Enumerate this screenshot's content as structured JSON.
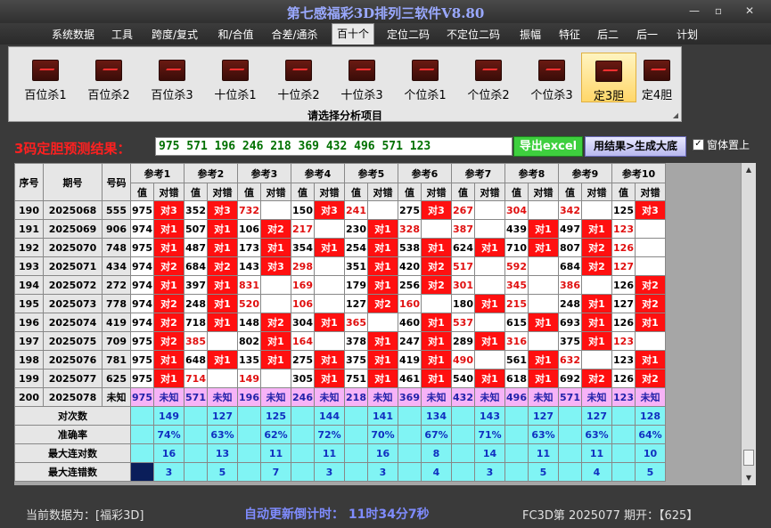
{
  "app": {
    "title": "第七感福彩3D排列三软件V8.80"
  },
  "window_controls": {
    "minimize": "—",
    "maximize": "▫",
    "close": "✕"
  },
  "menu": [
    {
      "label": "系统数据",
      "active": false
    },
    {
      "label": "工具",
      "active": false
    },
    {
      "label": "跨度/复式",
      "active": false
    },
    {
      "label": "和/合值",
      "active": false
    },
    {
      "label": "合差/通杀",
      "active": false
    },
    {
      "label": "百十个",
      "active": true
    },
    {
      "label": "定位二码",
      "active": false
    },
    {
      "label": "不定位二码",
      "active": false
    },
    {
      "label": "振幅",
      "active": false
    },
    {
      "label": "特征",
      "active": false
    },
    {
      "label": "后二",
      "active": false
    },
    {
      "label": "后一",
      "active": false
    },
    {
      "label": "计划",
      "active": false
    }
  ],
  "ribbon": {
    "buttons": [
      {
        "label": "百位杀1",
        "icon": "chart-icon",
        "selected": false
      },
      {
        "label": "百位杀2",
        "icon": "chart-icon",
        "selected": false
      },
      {
        "label": "百位杀3",
        "icon": "chart-icon",
        "selected": false
      },
      {
        "label": "十位杀1",
        "icon": "chart-icon",
        "selected": false
      },
      {
        "label": "十位杀2",
        "icon": "chart-icon",
        "selected": false
      },
      {
        "label": "十位杀3",
        "icon": "chart-icon",
        "selected": false
      },
      {
        "label": "个位杀1",
        "icon": "chart-icon",
        "selected": false
      },
      {
        "label": "个位杀2",
        "icon": "chart-icon",
        "selected": false
      },
      {
        "label": "个位杀3",
        "icon": "chart-icon",
        "selected": false
      },
      {
        "label": "定3胆",
        "icon": "chart-icon",
        "selected": true
      },
      {
        "label": "定4胆",
        "icon": "chart-icon",
        "selected": false
      }
    ],
    "caption": "请选择分析项目"
  },
  "result": {
    "label": "3码定胆预测结果：",
    "value": "975 571 196 246 218 369 432 496 571 123",
    "export_button": "导出excel",
    "apply_button": "用结果>生成大底",
    "ontop_checked": "✓",
    "ontop_label": "窗体置上"
  },
  "table": {
    "headers": {
      "seq": "序号",
      "period": "期号",
      "code": "号码",
      "value": "值",
      "check": "对错"
    },
    "refs": [
      "参考1",
      "参考2",
      "参考3",
      "参考4",
      "参考5",
      "参考6",
      "参考7",
      "参考8",
      "参考9",
      "参考10"
    ],
    "rows": [
      {
        "seq": "190",
        "period": "2025068",
        "code": "555",
        "cells": [
          {
            "v": "975",
            "red": false,
            "c": "对3"
          },
          {
            "v": "352",
            "red": false,
            "c": "对3"
          },
          {
            "v": "732",
            "red": true,
            "c": ""
          },
          {
            "v": "150",
            "red": false,
            "c": "对3"
          },
          {
            "v": "241",
            "red": true,
            "c": ""
          },
          {
            "v": "275",
            "red": false,
            "c": "对3"
          },
          {
            "v": "267",
            "red": true,
            "c": ""
          },
          {
            "v": "304",
            "red": true,
            "c": ""
          },
          {
            "v": "342",
            "red": true,
            "c": ""
          },
          {
            "v": "125",
            "red": false,
            "c": "对3"
          }
        ]
      },
      {
        "seq": "191",
        "period": "2025069",
        "code": "906",
        "cells": [
          {
            "v": "974",
            "red": false,
            "c": "对1"
          },
          {
            "v": "507",
            "red": false,
            "c": "对1"
          },
          {
            "v": "106",
            "red": false,
            "c": "对2"
          },
          {
            "v": "217",
            "red": true,
            "c": ""
          },
          {
            "v": "230",
            "red": false,
            "c": "对1"
          },
          {
            "v": "328",
            "red": true,
            "c": ""
          },
          {
            "v": "387",
            "red": true,
            "c": ""
          },
          {
            "v": "439",
            "red": false,
            "c": "对1"
          },
          {
            "v": "497",
            "red": false,
            "c": "对1"
          },
          {
            "v": "123",
            "red": true,
            "c": ""
          }
        ]
      },
      {
        "seq": "192",
        "period": "2025070",
        "code": "748",
        "cells": [
          {
            "v": "975",
            "red": false,
            "c": "对1"
          },
          {
            "v": "487",
            "red": false,
            "c": "对1"
          },
          {
            "v": "173",
            "red": false,
            "c": "对1"
          },
          {
            "v": "354",
            "red": false,
            "c": "对1"
          },
          {
            "v": "254",
            "red": false,
            "c": "对1"
          },
          {
            "v": "538",
            "red": false,
            "c": "对1"
          },
          {
            "v": "624",
            "red": false,
            "c": "对1"
          },
          {
            "v": "710",
            "red": false,
            "c": "对1"
          },
          {
            "v": "807",
            "red": false,
            "c": "对2"
          },
          {
            "v": "126",
            "red": true,
            "c": ""
          }
        ]
      },
      {
        "seq": "193",
        "period": "2025071",
        "code": "434",
        "cells": [
          {
            "v": "974",
            "red": false,
            "c": "对2"
          },
          {
            "v": "684",
            "red": false,
            "c": "对2"
          },
          {
            "v": "143",
            "red": false,
            "c": "对3"
          },
          {
            "v": "298",
            "red": true,
            "c": ""
          },
          {
            "v": "351",
            "red": false,
            "c": "对1"
          },
          {
            "v": "420",
            "red": false,
            "c": "对2"
          },
          {
            "v": "517",
            "red": true,
            "c": ""
          },
          {
            "v": "592",
            "red": true,
            "c": ""
          },
          {
            "v": "684",
            "red": false,
            "c": "对2"
          },
          {
            "v": "127",
            "red": true,
            "c": ""
          }
        ]
      },
      {
        "seq": "194",
        "period": "2025072",
        "code": "272",
        "cells": [
          {
            "v": "974",
            "red": false,
            "c": "对1"
          },
          {
            "v": "397",
            "red": false,
            "c": "对1"
          },
          {
            "v": "831",
            "red": true,
            "c": ""
          },
          {
            "v": "169",
            "red": true,
            "c": ""
          },
          {
            "v": "179",
            "red": false,
            "c": "对1"
          },
          {
            "v": "256",
            "red": false,
            "c": "对2"
          },
          {
            "v": "301",
            "red": true,
            "c": ""
          },
          {
            "v": "345",
            "red": true,
            "c": ""
          },
          {
            "v": "386",
            "red": true,
            "c": ""
          },
          {
            "v": "126",
            "red": false,
            "c": "对2"
          }
        ]
      },
      {
        "seq": "195",
        "period": "2025073",
        "code": "778",
        "cells": [
          {
            "v": "974",
            "red": false,
            "c": "对2"
          },
          {
            "v": "248",
            "red": false,
            "c": "对1"
          },
          {
            "v": "520",
            "red": true,
            "c": ""
          },
          {
            "v": "106",
            "red": true,
            "c": ""
          },
          {
            "v": "127",
            "red": false,
            "c": "对2"
          },
          {
            "v": "160",
            "red": true,
            "c": ""
          },
          {
            "v": "180",
            "red": false,
            "c": "对1"
          },
          {
            "v": "215",
            "red": true,
            "c": ""
          },
          {
            "v": "248",
            "red": false,
            "c": "对1"
          },
          {
            "v": "127",
            "red": false,
            "c": "对2"
          }
        ]
      },
      {
        "seq": "196",
        "period": "2025074",
        "code": "419",
        "cells": [
          {
            "v": "974",
            "red": false,
            "c": "对2"
          },
          {
            "v": "718",
            "red": false,
            "c": "对1"
          },
          {
            "v": "148",
            "red": false,
            "c": "对2"
          },
          {
            "v": "304",
            "red": false,
            "c": "对1"
          },
          {
            "v": "365",
            "red": true,
            "c": ""
          },
          {
            "v": "460",
            "red": false,
            "c": "对1"
          },
          {
            "v": "537",
            "red": true,
            "c": ""
          },
          {
            "v": "615",
            "red": false,
            "c": "对1"
          },
          {
            "v": "693",
            "red": false,
            "c": "对1"
          },
          {
            "v": "126",
            "red": false,
            "c": "对1"
          }
        ]
      },
      {
        "seq": "197",
        "period": "2025075",
        "code": "709",
        "cells": [
          {
            "v": "975",
            "red": false,
            "c": "对2"
          },
          {
            "v": "385",
            "red": true,
            "c": ""
          },
          {
            "v": "802",
            "red": false,
            "c": "对1"
          },
          {
            "v": "164",
            "red": true,
            "c": ""
          },
          {
            "v": "378",
            "red": false,
            "c": "对1"
          },
          {
            "v": "247",
            "red": false,
            "c": "对1"
          },
          {
            "v": "289",
            "red": false,
            "c": "对1"
          },
          {
            "v": "316",
            "red": true,
            "c": ""
          },
          {
            "v": "375",
            "red": false,
            "c": "对1"
          },
          {
            "v": "123",
            "red": true,
            "c": ""
          }
        ]
      },
      {
        "seq": "198",
        "period": "2025076",
        "code": "781",
        "cells": [
          {
            "v": "975",
            "red": false,
            "c": "对1"
          },
          {
            "v": "648",
            "red": false,
            "c": "对1"
          },
          {
            "v": "135",
            "red": false,
            "c": "对1"
          },
          {
            "v": "275",
            "red": false,
            "c": "对1"
          },
          {
            "v": "375",
            "red": false,
            "c": "对1"
          },
          {
            "v": "419",
            "red": false,
            "c": "对1"
          },
          {
            "v": "490",
            "red": true,
            "c": ""
          },
          {
            "v": "561",
            "red": false,
            "c": "对1"
          },
          {
            "v": "632",
            "red": true,
            "c": ""
          },
          {
            "v": "123",
            "red": false,
            "c": "对1"
          }
        ]
      },
      {
        "seq": "199",
        "period": "2025077",
        "code": "625",
        "cells": [
          {
            "v": "975",
            "red": false,
            "c": "对1"
          },
          {
            "v": "714",
            "red": true,
            "c": ""
          },
          {
            "v": "149",
            "red": true,
            "c": ""
          },
          {
            "v": "305",
            "red": false,
            "c": "对1"
          },
          {
            "v": "751",
            "red": false,
            "c": "对1"
          },
          {
            "v": "461",
            "red": false,
            "c": "对1"
          },
          {
            "v": "540",
            "red": false,
            "c": "对1"
          },
          {
            "v": "618",
            "red": false,
            "c": "对1"
          },
          {
            "v": "692",
            "red": false,
            "c": "对2"
          },
          {
            "v": "126",
            "red": false,
            "c": "对2"
          }
        ]
      }
    ],
    "pending_row": {
      "seq": "200",
      "period": "2025078",
      "code": "未知",
      "values": [
        "975",
        "571",
        "196",
        "246",
        "218",
        "369",
        "432",
        "496",
        "571",
        "123"
      ],
      "check": "未知"
    },
    "stats": [
      {
        "label": "对次数",
        "values": [
          "149",
          "127",
          "125",
          "144",
          "141",
          "134",
          "143",
          "127",
          "127",
          "128"
        ]
      },
      {
        "label": "准确率",
        "values": [
          "74%",
          "63%",
          "62%",
          "72%",
          "70%",
          "67%",
          "71%",
          "63%",
          "63%",
          "64%"
        ]
      },
      {
        "label": "最大连对数",
        "values": [
          "16",
          "13",
          "11",
          "11",
          "16",
          "8",
          "14",
          "11",
          "11",
          "10"
        ]
      },
      {
        "label": "最大连错数",
        "values": [
          "3",
          "5",
          "7",
          "3",
          "3",
          "4",
          "3",
          "5",
          "4",
          "5"
        ]
      }
    ]
  },
  "status": {
    "left": "当前数据为：[福彩3D]",
    "countdown": "自动更新倒计时：  11时34分7秒",
    "right": "FC3D第 2025077 期开：【625】"
  },
  "colors": {
    "hit": "#ff1010",
    "pending": "#f7b3f7",
    "stats": "#80f4f4",
    "prediction_text": "#007000",
    "title": "#9aa9ff"
  }
}
